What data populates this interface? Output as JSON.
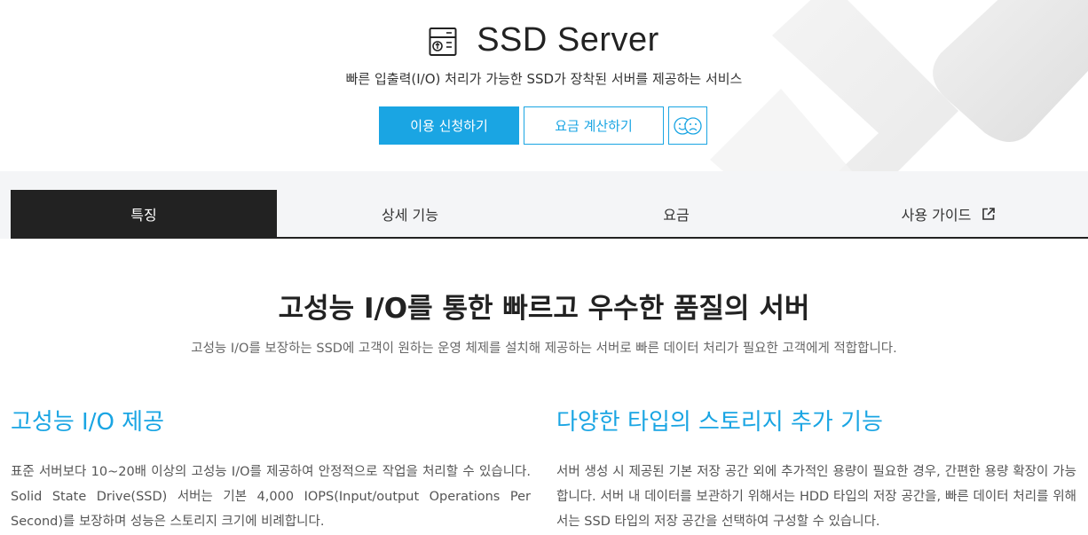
{
  "hero": {
    "title": "SSD Server",
    "subtitle": "빠른 입출력(I/O) 처리가 가능한 SSD가 장착된 서버를 제공하는 서비스",
    "icon": "server-icon",
    "buttons": {
      "apply": "이용 신청하기",
      "calculate": "요금 계산하기",
      "feedback_icon": "feedback-faces-icon"
    }
  },
  "tabs": [
    {
      "label": "특징",
      "active": true
    },
    {
      "label": "상세 기능",
      "active": false
    },
    {
      "label": "요금",
      "active": false
    },
    {
      "label": "사용 가이드",
      "active": false,
      "icon": "external-link-icon"
    }
  ],
  "intro": {
    "title": "고성능 I/O를 통한 빠르고 우수한 품질의 서버",
    "description": "고성능 I/O를 보장하는 SSD에 고객이 원하는 운영 체제를 설치해 제공하는 서버로 빠른 데이터 처리가 필요한 고객에게 적합합니다."
  },
  "features": [
    {
      "title": "고성능 I/O 제공",
      "body": "표준 서버보다 10~20배 이상의 고성능 I/O를 제공하여 안정적으로 작업을 처리할 수 있습니다. Solid State Drive(SSD) 서버는 기본 4,000 IOPS(Input/output Operations Per Second)를 보장하며 성능은 스토리지 크기에 비례합니다."
    },
    {
      "title": "다양한 타입의 스토리지 추가 기능",
      "body": "서버 생성 시 제공된 기본 저장 공간 외에 추가적인 용량이 필요한 경우, 간편한 용량 확장이 가능합니다. 서버 내 데이터를 보관하기 위해서는 HDD 타입의 저장 공간을, 빠른 데이터 처리를 위해서는 SSD 타입의 저장 공간을 선택하여 구성할 수 있습니다."
    }
  ],
  "colors": {
    "accent": "#1aa5e3",
    "tab_active_bg": "#222222",
    "tabbar_bg": "#f4f5f7"
  }
}
